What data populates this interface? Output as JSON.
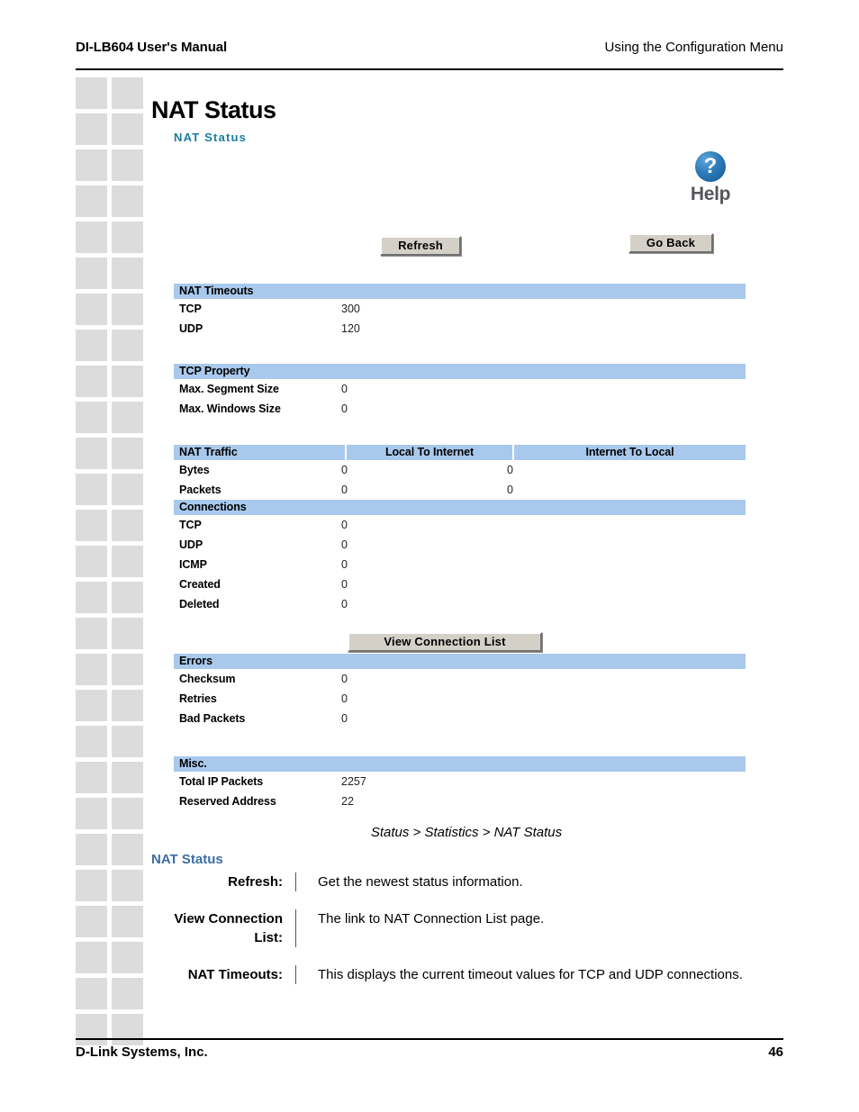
{
  "page_header": {
    "left": "DI-LB604 User's Manual",
    "right": "Using the Configuration Menu"
  },
  "page_footer": {
    "left": "D-Link Systems, Inc.",
    "page_number": "46"
  },
  "screenshot": {
    "main_title": "NAT Status",
    "sub_title": "NAT Status",
    "help": {
      "glyph": "?",
      "label": "Help"
    },
    "buttons": {
      "refresh": "Refresh",
      "go_back": "Go Back",
      "view_connection_list": "View Connection List"
    },
    "sections": {
      "nat_timeouts": {
        "header": "NAT Timeouts",
        "rows": [
          {
            "label": "TCP",
            "value": "300"
          },
          {
            "label": "UDP",
            "value": "120"
          }
        ]
      },
      "tcp_property": {
        "header": "TCP Property",
        "rows": [
          {
            "label": "Max. Segment Size",
            "value": "0"
          },
          {
            "label": "Max. Windows Size",
            "value": "0"
          }
        ]
      },
      "nat_traffic": {
        "header": "NAT Traffic",
        "col2": "Local To Internet",
        "col3": "Internet To Local",
        "rows": [
          {
            "label": "Bytes",
            "value": "0",
            "value2": "0"
          },
          {
            "label": "Packets",
            "value": "0",
            "value2": "0"
          }
        ]
      },
      "connections": {
        "header": "Connections",
        "rows": [
          {
            "label": "TCP",
            "value": "0"
          },
          {
            "label": "UDP",
            "value": "0"
          },
          {
            "label": "ICMP",
            "value": "0"
          },
          {
            "label": "Created",
            "value": "0"
          },
          {
            "label": "Deleted",
            "value": "0"
          }
        ]
      },
      "errors": {
        "header": "Errors",
        "rows": [
          {
            "label": "Checksum",
            "value": "0"
          },
          {
            "label": "Retries",
            "value": "0"
          },
          {
            "label": "Bad Packets",
            "value": "0"
          }
        ]
      },
      "misc": {
        "header": "Misc.",
        "rows": [
          {
            "label": "Total IP Packets",
            "value": "2257"
          },
          {
            "label": "Reserved Address",
            "value": "22"
          }
        ]
      }
    }
  },
  "caption": "Status > Statistics > NAT Status",
  "description": {
    "title": "NAT Status",
    "items": [
      {
        "term": "Refresh:",
        "definition": "Get the newest status information."
      },
      {
        "term": "View Connection List:",
        "definition": "The link to NAT Connection List page."
      },
      {
        "term": "NAT Timeouts:",
        "definition": "This displays the current timeout values for TCP and UDP connections."
      }
    ]
  },
  "colors": {
    "section_header_blue": "#a9c9ec",
    "sub_title_teal": "#1b7c9e",
    "desc_title_blue": "#3b6ea5",
    "button_face": "#d4d0c8",
    "deco_square": "#dcdcdc"
  }
}
